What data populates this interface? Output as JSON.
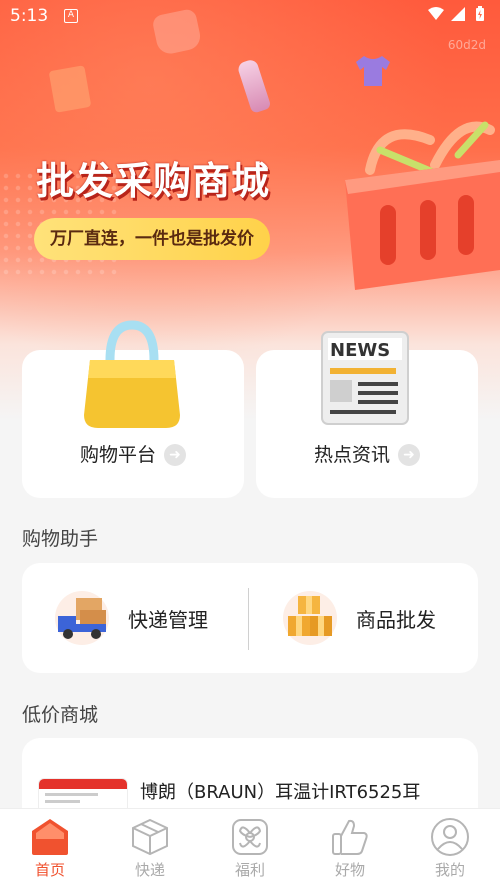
{
  "status_bar": {
    "time": "5:13",
    "notification_icon": "A"
  },
  "watermark": "60d2d",
  "hero": {
    "title": "批发采购商城",
    "subtitle": "万厂直连，一件也是批发价"
  },
  "nav_cards": [
    {
      "label": "购物平台",
      "icon": "shopping-bag-icon"
    },
    {
      "label": "热点资讯",
      "icon": "newspaper-icon"
    }
  ],
  "helper_section": {
    "title": "购物助手",
    "items": [
      {
        "label": "快递管理",
        "icon": "delivery-truck-icon"
      },
      {
        "label": "商品批发",
        "icon": "boxes-icon"
      }
    ]
  },
  "low_price_section": {
    "title": "低价商城",
    "product": {
      "title": "博朗（BRAUN）耳温计IRT6525耳"
    }
  },
  "tabbar": {
    "tabs": [
      {
        "label": "首页",
        "icon": "home-icon",
        "active": true
      },
      {
        "label": "快递",
        "icon": "package-icon",
        "active": false
      },
      {
        "label": "福利",
        "icon": "gift-icon",
        "active": false
      },
      {
        "label": "好物",
        "icon": "thumbs-up-icon",
        "active": false
      },
      {
        "label": "我的",
        "icon": "user-icon",
        "active": false
      }
    ]
  },
  "colors": {
    "accent": "#f0522f",
    "hero_top": "#ff5a3c",
    "pill": "#ffd24a",
    "inactive_tab": "#aaaaaa"
  }
}
